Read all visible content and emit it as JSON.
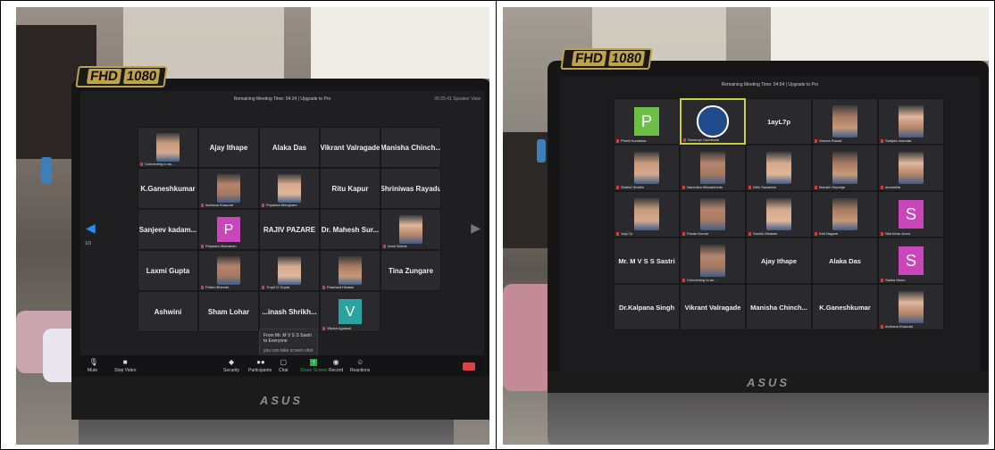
{
  "left_photo": {
    "brand": {
      "fhd": "FHD",
      "res": "1080",
      "laptop": "ASUS"
    },
    "meeting_bar": "Remaining Meeting Time: 04:24 | Upgrade to Pro",
    "meeting_bar_right": "00:25:41   Speaker View",
    "page_indicator": "1/3",
    "tiles": [
      {
        "name": "Connecting to au...",
        "kind": "video"
      },
      {
        "name": "Ajay Ithape",
        "kind": "name"
      },
      {
        "name": "Alaka Das",
        "kind": "name"
      },
      {
        "name": "Vikrant Valragade",
        "kind": "name"
      },
      {
        "name": "Manisha Chinch...",
        "kind": "name"
      },
      {
        "name": "K.Ganeshkumar",
        "kind": "name"
      },
      {
        "name": "Archana Khandat",
        "kind": "video"
      },
      {
        "name": "Priyanka Monghare",
        "kind": "video"
      },
      {
        "name": "Ritu Kapur",
        "kind": "name"
      },
      {
        "name": "Shriniwas Rayadu",
        "kind": "name"
      },
      {
        "name": "Sanjeev kadam...",
        "kind": "name"
      },
      {
        "name": "Priyanka Wamanan",
        "kind": "avatar",
        "letter": "P"
      },
      {
        "name": "RAJIV PAZARE",
        "kind": "name"
      },
      {
        "name": "Dr. Mahesh Sur...",
        "kind": "name"
      },
      {
        "name": "Amol Bobde",
        "kind": "video"
      },
      {
        "name": "Laxmi Gupta",
        "kind": "name"
      },
      {
        "name": "Pritam Bhende",
        "kind": "video"
      },
      {
        "name": "Trupti D Gupta",
        "kind": "video"
      },
      {
        "name": "Prashant Hiwase",
        "kind": "video"
      },
      {
        "name": "Tina Zungare",
        "kind": "name"
      },
      {
        "name": "Ashwini",
        "kind": "name"
      },
      {
        "name": "Sham Lohar",
        "kind": "name"
      },
      {
        "name": "...inash Shrikh...",
        "kind": "name"
      },
      {
        "name": "Vikash Agrawal",
        "kind": "avatar",
        "letter": "V"
      }
    ],
    "chat_popup": {
      "title": "From Mr. M V S S Sastri to Everyone",
      "body": "you can take screen shot"
    },
    "toolbar": [
      "Mute",
      "Stop Video",
      "Security",
      "Participants",
      "Chat",
      "Share Screen",
      "Record",
      "Reactions"
    ],
    "participants_count": "41"
  },
  "right_photo": {
    "brand": {
      "fhd": "FHD",
      "res": "1080",
      "laptop": "ASUS"
    },
    "meeting_bar": "Remaining Meeting Time: 04:54 | Upgrade to Pro",
    "tiles": [
      {
        "name": "Preeti Kundekar",
        "kind": "avatar",
        "letter": "P"
      },
      {
        "name": "Swarrupi Gandewar",
        "kind": "logo"
      },
      {
        "name": "1ayL7p",
        "kind": "name"
      },
      {
        "name": "Seema Rawat",
        "kind": "video"
      },
      {
        "name": "Sadipta Inamdar",
        "kind": "video"
      },
      {
        "name": "Shahid Sheikh",
        "kind": "video"
      },
      {
        "name": "Narendra Wanarkhede",
        "kind": "video"
      },
      {
        "name": "Nitin Sawarkar",
        "kind": "video"
      },
      {
        "name": "Manish Girpunje",
        "kind": "video"
      },
      {
        "name": "anuradha",
        "kind": "video"
      },
      {
        "name": "1ayL7p",
        "kind": "video"
      },
      {
        "name": "Pavan Kumar",
        "kind": "video"
      },
      {
        "name": "Sachin Mhaske",
        "kind": "video"
      },
      {
        "name": "Kirti Nagare",
        "kind": "video"
      },
      {
        "name": "Sita Kiran Arora",
        "kind": "avatar",
        "letter": "S"
      },
      {
        "name": "Mr. M V S S Sastri",
        "kind": "name"
      },
      {
        "name": "Connecting to au...",
        "kind": "video"
      },
      {
        "name": "Ajay Ithape",
        "kind": "name"
      },
      {
        "name": "Alaka Das",
        "kind": "name"
      },
      {
        "name": "Sarika Moon",
        "kind": "avatar",
        "letter": "S"
      },
      {
        "name": "Dr.Kalpana Singh",
        "kind": "name"
      },
      {
        "name": "Vikrant Valragade",
        "kind": "name"
      },
      {
        "name": "Manisha Chinch...",
        "kind": "name"
      },
      {
        "name": "K.Ganeshkumar",
        "kind": "name"
      },
      {
        "name": "Archana Khandat",
        "kind": "video"
      }
    ]
  }
}
